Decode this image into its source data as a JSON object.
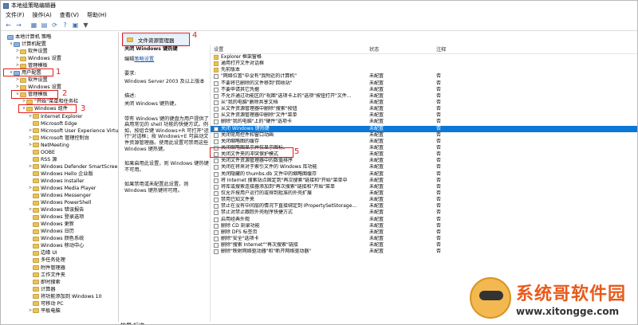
{
  "window": {
    "title": "本地组策略编辑器"
  },
  "menu": [
    "文件(F)",
    "操作(A)",
    "查看(V)",
    "帮助(H)"
  ],
  "tree": [
    {
      "label": "本地计算机 策略",
      "level": 0,
      "toggle": "",
      "icon": "pc"
    },
    {
      "label": "计算机配置",
      "level": 1,
      "toggle": "v",
      "icon": "pc"
    },
    {
      "label": "软件设置",
      "level": 2,
      "toggle": ">",
      "icon": "folder"
    },
    {
      "label": "Windows 设置",
      "level": 2,
      "toggle": ">",
      "icon": "folder"
    },
    {
      "label": "管理模板",
      "level": 2,
      "toggle": ">",
      "icon": "folder"
    },
    {
      "label": "用户配置",
      "level": 1,
      "toggle": "v",
      "icon": "pc"
    },
    {
      "label": "软件设置",
      "level": 2,
      "toggle": ">",
      "icon": "folder"
    },
    {
      "label": "Windows 设置",
      "level": 2,
      "toggle": ">",
      "icon": "folder"
    },
    {
      "label": "管理模板",
      "level": 2,
      "toggle": "v",
      "icon": "folder"
    },
    {
      "label": "\"开始\"菜单和任务栏",
      "level": 3,
      "toggle": ">",
      "icon": "folder"
    },
    {
      "label": "Windows 组件",
      "level": 3,
      "toggle": "v",
      "icon": "folder"
    },
    {
      "label": "Internet Explorer",
      "level": 4,
      "toggle": ">",
      "icon": "folder"
    },
    {
      "label": "Microsoft Edge",
      "level": 4,
      "toggle": "",
      "icon": "folder"
    },
    {
      "label": "Microsoft User Experience Virtu",
      "level": 4,
      "toggle": ">",
      "icon": "folder"
    },
    {
      "label": "Microsoft 管理控制台",
      "level": 4,
      "toggle": ">",
      "icon": "folder"
    },
    {
      "label": "NetMeeting",
      "level": 4,
      "toggle": ">",
      "icon": "folder"
    },
    {
      "label": "OOBE",
      "level": 4,
      "toggle": "",
      "icon": "folder"
    },
    {
      "label": "RSS 源",
      "level": 4,
      "toggle": "",
      "icon": "folder"
    },
    {
      "label": "Windows Defender SmartScree",
      "level": 4,
      "toggle": ">",
      "icon": "folder"
    },
    {
      "label": "Windows Hello 企业版",
      "level": 4,
      "toggle": "",
      "icon": "folder"
    },
    {
      "label": "Windows Installer",
      "level": 4,
      "toggle": "",
      "icon": "folder"
    },
    {
      "label": "Windows Media Player",
      "level": 4,
      "toggle": ">",
      "icon": "folder"
    },
    {
      "label": "Windows Messenger",
      "level": 4,
      "toggle": "",
      "icon": "folder"
    },
    {
      "label": "Windows PowerShell",
      "level": 4,
      "toggle": "",
      "icon": "folder"
    },
    {
      "label": "Windows 错误报告",
      "level": 4,
      "toggle": ">",
      "icon": "folder"
    },
    {
      "label": "Windows 登录选项",
      "level": 4,
      "toggle": "",
      "icon": "folder"
    },
    {
      "label": "Windows 更新",
      "level": 4,
      "toggle": "",
      "icon": "folder"
    },
    {
      "label": "Windows 日历",
      "level": 4,
      "toggle": "",
      "icon": "folder"
    },
    {
      "label": "Windows 颜色系统",
      "level": 4,
      "toggle": "",
      "icon": "folder"
    },
    {
      "label": "Windows 移动中心",
      "level": 4,
      "toggle": "",
      "icon": "folder"
    },
    {
      "label": "边缘 UI",
      "level": 4,
      "toggle": "",
      "icon": "folder"
    },
    {
      "label": "多任务处理",
      "level": 4,
      "toggle": "",
      "icon": "folder"
    },
    {
      "label": "附件管理器",
      "level": 4,
      "toggle": "",
      "icon": "folder"
    },
    {
      "label": "工作文件夹",
      "level": 4,
      "toggle": "",
      "icon": "folder"
    },
    {
      "label": "即时搜索",
      "level": 4,
      "toggle": "",
      "icon": "folder"
    },
    {
      "label": "计算器",
      "level": 4,
      "toggle": "",
      "icon": "folder"
    },
    {
      "label": "将功能添加到 Windows 10",
      "level": 4,
      "toggle": "",
      "icon": "folder"
    },
    {
      "label": "可移动 PC",
      "level": 4,
      "toggle": "",
      "icon": "folder"
    },
    {
      "label": "平板电脑",
      "level": 4,
      "toggle": ">",
      "icon": "folder"
    }
  ],
  "tabs": [
    "扩展",
    "标准"
  ],
  "breadcrumb": "文件资源管理器",
  "description": {
    "title": "关闭 Windows 键热键",
    "edit_prefix": "编辑",
    "edit_link": "策略设置",
    "requirements_label": "要求:",
    "requirements": "Windows Server 2003 及以上版本",
    "desc_label": "描述:",
    "desc_text": "关闭 Windows 键热键。",
    "body1": "带有 Windows 键的键盘为用户提供了启用常见的 shell 功能的快捷方式。例如，按组合键 Windows+R 可打开\"运行\"对话框；按 Windows+E 可启动文件资源管理器。使用此设置可禁用这些 Windows 键热键。",
    "body2": "如果启用此设置，则 Windows 键热键不可用。",
    "body3": "如果禁用或未配置此设置，则 Windows 键热键将可用。"
  },
  "columns": {
    "name": "设置",
    "state": "状态",
    "comment": "注释"
  },
  "rows": [
    {
      "name": "Explorer 框架窗格",
      "state": "",
      "comment": "",
      "folder": true
    },
    {
      "name": "通用打开文件对话框",
      "state": "",
      "comment": "",
      "folder": true
    },
    {
      "name": "先前版本",
      "state": "",
      "comment": "",
      "folder": true
    },
    {
      "name": "\"网络位置\"中没有\"我附近的计算机\"",
      "state": "未配置",
      "comment": "否"
    },
    {
      "name": "不要将已删除的文件移到\"回收站\"",
      "state": "未配置",
      "comment": "否"
    },
    {
      "name": "不要申请其它凭据",
      "state": "未配置",
      "comment": "否"
    },
    {
      "name": "不允许通过功能区的\"视图\"选项卡上的\"选项\"按钮打开\"文件...",
      "state": "未配置",
      "comment": "否"
    },
    {
      "name": "从\"我的电脑\"删除共享文档",
      "state": "未配置",
      "comment": "否"
    },
    {
      "name": "从文件资源管理器中删除\"搜索\"按钮",
      "state": "未配置",
      "comment": "否"
    },
    {
      "name": "从文件资源管理器中删除\"文件\"菜单",
      "state": "未配置",
      "comment": "否"
    },
    {
      "name": "删除\"我的电脑\"上的\"硬件\"选项卡",
      "state": "未配置",
      "comment": "否"
    },
    {
      "name": "关闭 Windows 键热键",
      "state": "未配置",
      "comment": "否",
      "selected": true
    },
    {
      "name": "关闭常用控件和窗口动画",
      "state": "未配置",
      "comment": "否"
    },
    {
      "name": "关闭缩略图的缓存",
      "state": "未配置",
      "comment": "否"
    },
    {
      "name": "关闭缩略图显示并仅显示图标。",
      "state": "未配置",
      "comment": "否"
    },
    {
      "name": "关闭文件夹的冲突保护模式",
      "state": "未配置",
      "comment": "否"
    },
    {
      "name": "关闭文件资源管理器中的数值排序",
      "state": "未配置",
      "comment": "否"
    },
    {
      "name": "关闭在将来对于索引文件的 Windows 库功能",
      "state": "未配置",
      "comment": "否"
    },
    {
      "name": "关闭隐藏的 thumbs.db 文件中的缩略图缓存",
      "state": "未配置",
      "comment": "否"
    },
    {
      "name": "将 Internet 搜索站点固定到\"再次搜索\"链接和\"开始\"菜单中",
      "state": "未配置",
      "comment": "否"
    },
    {
      "name": "将库或搜索连接器添加到\"再次搜索\"链接和\"开始\"菜单",
      "state": "未配置",
      "comment": "否"
    },
    {
      "name": "仅允许按用户运行的或得到批准的外壳扩展",
      "state": "未配置",
      "comment": "否"
    },
    {
      "name": "禁用已知文件夹",
      "state": "未配置",
      "comment": "否"
    },
    {
      "name": "禁止在没有中间层的情况下直接绑定到 IPropertySetStorage...",
      "state": "未配置",
      "comment": "否"
    },
    {
      "name": "禁止对禁止跟踪外壳程序快捷方式",
      "state": "未配置",
      "comment": "否"
    },
    {
      "name": "启用经典外观",
      "state": "未配置",
      "comment": "否"
    },
    {
      "name": "删除 CD 刻录功能",
      "state": "未配置",
      "comment": "否"
    },
    {
      "name": "删除 DFS 标签页",
      "state": "未配置",
      "comment": "否"
    },
    {
      "name": "删除\"安全\"选项卡",
      "state": "未配置",
      "comment": "否"
    },
    {
      "name": "删除\"搜索 Internet\"\"再次搜索\"链接",
      "state": "未配置",
      "comment": "否"
    },
    {
      "name": "删除\"映射网络驱动器\"和\"断开网络驱动器\"",
      "state": "未配置",
      "comment": "否"
    }
  ],
  "annotations": [
    "1",
    "2",
    "3",
    "4",
    "5"
  ],
  "watermark": {
    "title": "系统哥软件园",
    "url": "www.xitongge.com"
  }
}
